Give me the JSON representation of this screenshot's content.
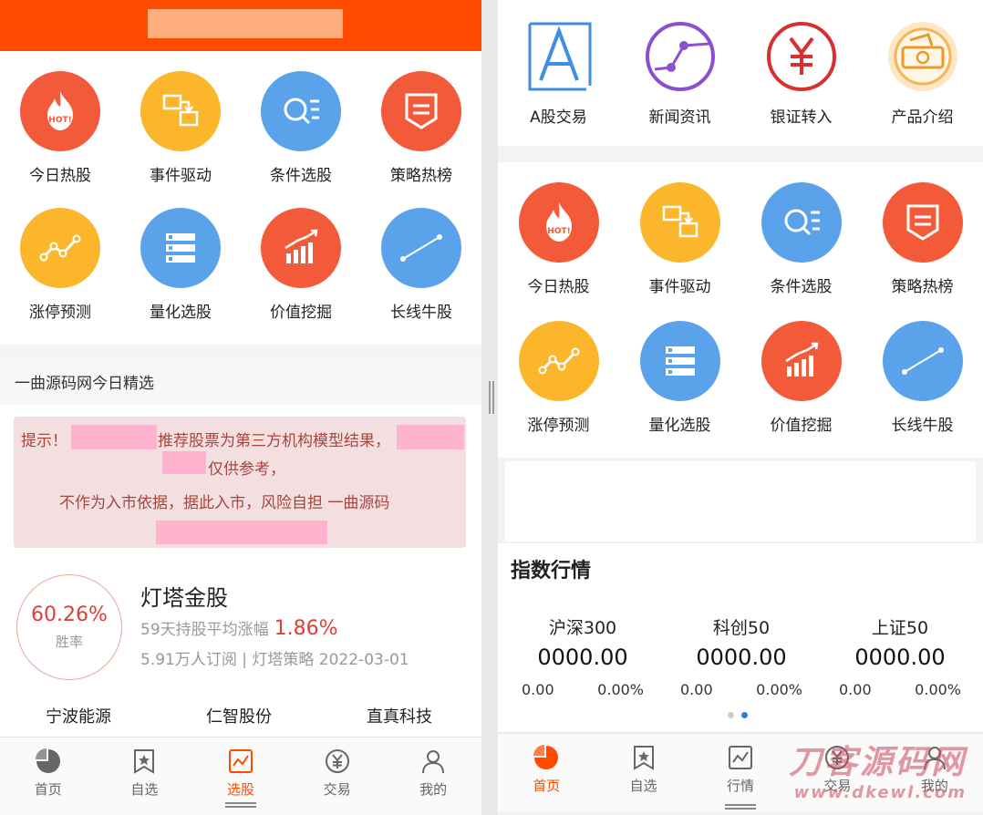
{
  "left": {
    "grid": [
      {
        "label": "今日热股",
        "icon": "hot-fire-icon",
        "color": "red"
      },
      {
        "label": "事件驱动",
        "icon": "event-flow-icon",
        "color": "yellow"
      },
      {
        "label": "条件选股",
        "icon": "condition-search-icon",
        "color": "blue"
      },
      {
        "label": "策略热榜",
        "icon": "strategy-banner-icon",
        "color": "red"
      },
      {
        "label": "涨停预测",
        "icon": "trend-line-icon",
        "color": "yellow"
      },
      {
        "label": "量化选股",
        "icon": "server-list-icon",
        "color": "blue"
      },
      {
        "label": "价值挖掘",
        "icon": "bar-growth-icon",
        "color": "red"
      },
      {
        "label": "长线牛股",
        "icon": "long-line-icon",
        "color": "blue"
      }
    ],
    "picks_title": "一曲源码网今日精选",
    "notice": {
      "prefix": "提示！",
      "line1_text": "推荐股票为第三方机构模型结果，",
      "line2_text": "仅供参考，",
      "line3_text": "不作为入市依据，据此入市，风险自担 一曲源码"
    },
    "stat": {
      "win_rate": "60.26%",
      "win_label": "胜率"
    },
    "stock": {
      "title": "灯塔金股",
      "hold_text": "59天持股平均涨幅",
      "hold_gain": "1.86%",
      "meta": "5.91万人订阅 | 灯塔策略 2022-03-01"
    },
    "stocks": [
      "宁波能源",
      "仁智股份",
      "直真科技"
    ],
    "nav": [
      {
        "label": "首页",
        "icon": "pie-home-icon",
        "active": false
      },
      {
        "label": "自选",
        "icon": "bookmark-star-icon",
        "active": false
      },
      {
        "label": "选股",
        "icon": "chart-pick-icon",
        "active": true
      },
      {
        "label": "交易",
        "icon": "yen-trade-icon",
        "active": false
      },
      {
        "label": "我的",
        "icon": "user-icon",
        "active": false
      }
    ]
  },
  "right": {
    "top_icons": [
      {
        "label": "A股交易",
        "icon": "a-share-icon"
      },
      {
        "label": "新闻资讯",
        "icon": "news-line-icon"
      },
      {
        "label": "银证转入",
        "icon": "yen-transfer-icon"
      },
      {
        "label": "产品介绍",
        "icon": "product-ticket-icon"
      }
    ],
    "grid": [
      {
        "label": "今日热股",
        "icon": "hot-fire-icon",
        "color": "red"
      },
      {
        "label": "事件驱动",
        "icon": "event-flow-icon",
        "color": "yellow"
      },
      {
        "label": "条件选股",
        "icon": "condition-search-icon",
        "color": "blue"
      },
      {
        "label": "策略热榜",
        "icon": "strategy-banner-icon",
        "color": "red"
      },
      {
        "label": "涨停预测",
        "icon": "trend-line-icon",
        "color": "yellow"
      },
      {
        "label": "量化选股",
        "icon": "server-list-icon",
        "color": "blue"
      },
      {
        "label": "价值挖掘",
        "icon": "bar-growth-icon",
        "color": "red"
      },
      {
        "label": "长线牛股",
        "icon": "long-line-icon",
        "color": "blue"
      }
    ],
    "index_title": "指数行情",
    "indices": [
      {
        "name": "沪深300",
        "value": "0000.00",
        "change": "0.00",
        "pct": "0.00%"
      },
      {
        "name": "科创50",
        "value": "0000.00",
        "change": "0.00",
        "pct": "0.00%"
      },
      {
        "name": "上证50",
        "value": "0000.00",
        "change": "0.00",
        "pct": "0.00%"
      }
    ],
    "nav": [
      {
        "label": "首页",
        "icon": "pie-home-icon",
        "active": true
      },
      {
        "label": "自选",
        "icon": "bookmark-star-icon",
        "active": false
      },
      {
        "label": "行情",
        "icon": "market-chart-icon",
        "active": false
      },
      {
        "label": "交易",
        "icon": "yen-trade-icon",
        "active": false
      },
      {
        "label": "我的",
        "icon": "user-icon",
        "active": false
      }
    ],
    "watermark": {
      "line1": "刀客源码网",
      "line2": "www.dkewl.com"
    }
  },
  "colors": {
    "brand": "#ff4a00",
    "red": "#f25a3a",
    "yellow": "#fbb62b",
    "blue": "#5aa3ea",
    "up": "#e13d39"
  }
}
